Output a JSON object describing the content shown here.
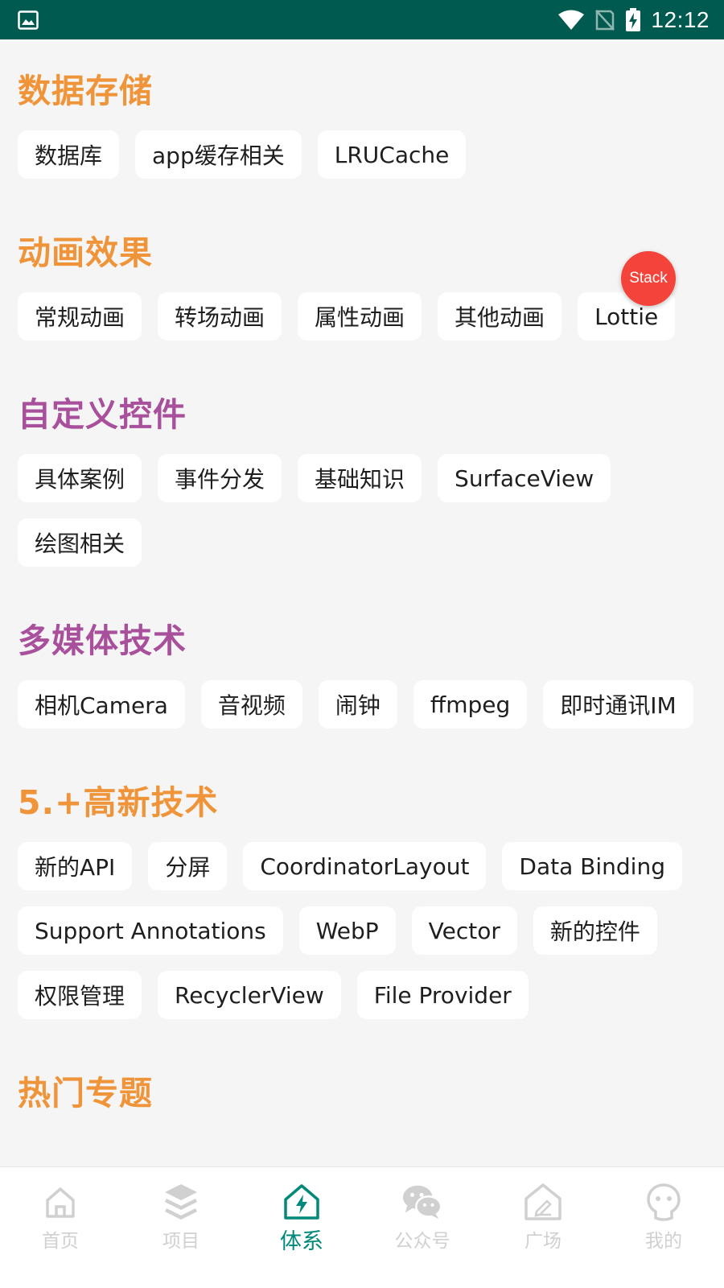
{
  "status_bar": {
    "time": "12:12",
    "icons": [
      "image-icon",
      "wifi-icon",
      "no-signal-icon",
      "battery-charging-icon"
    ]
  },
  "colors": {
    "status_bar": "#005a4f",
    "orange": "#f0943a",
    "purple": "#a8509c",
    "badge": "#f4433a",
    "active_tab": "#00897b",
    "inactive_tab": "#d0d0d0"
  },
  "sections": [
    {
      "title": "数据存储",
      "color": "#f0943a",
      "chips": [
        "数据库",
        "app缓存相关",
        "LRUCache"
      ]
    },
    {
      "title": "动画效果",
      "color": "#f0943a",
      "chips": [
        "常规动画",
        "转场动画",
        "属性动画",
        "其他动画",
        "Lottie"
      ]
    },
    {
      "title": "自定义控件",
      "color": "#a8509c",
      "chips": [
        "具体案例",
        "事件分发",
        "基础知识",
        "SurfaceView",
        "绘图相关"
      ]
    },
    {
      "title": "多媒体技术",
      "color": "#a8509c",
      "chips": [
        "相机Camera",
        "音视频",
        "闹钟",
        "ffmpeg",
        "即时通讯IM"
      ]
    },
    {
      "title": "5.+高新技术",
      "color": "#f0943a",
      "chips": [
        "新的API",
        "分屏",
        "CoordinatorLayout",
        "Data Binding",
        "Support Annotations",
        "WebP",
        "Vector",
        "新的控件",
        "权限管理",
        "RecyclerView",
        "File Provider"
      ]
    },
    {
      "title": "热门专题",
      "color": "#f0943a",
      "chips": []
    }
  ],
  "floating_badge": {
    "label": "Stack"
  },
  "bottom_nav": [
    {
      "label": "首页",
      "icon": "home-icon",
      "active": false
    },
    {
      "label": "项目",
      "icon": "layers-icon",
      "active": false
    },
    {
      "label": "体系",
      "icon": "system-house-bolt-icon",
      "active": true
    },
    {
      "label": "公众号",
      "icon": "wechat-icon",
      "active": false
    },
    {
      "label": "广场",
      "icon": "square-house-icon",
      "active": false
    },
    {
      "label": "我的",
      "icon": "profile-face-icon",
      "active": false
    }
  ]
}
